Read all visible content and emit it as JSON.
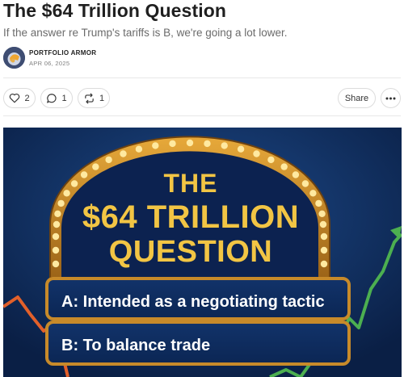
{
  "post": {
    "title": "The $64 Trillion Question",
    "subtitle": "If the answer re Trump's tariffs is B, we're going a lot lower.",
    "author": "PORTFOLIO ARMOR",
    "date": "APR 06, 2025"
  },
  "actions": {
    "likes": "2",
    "comments": "1",
    "restacks": "1",
    "share_label": "Share",
    "more_icon": "ellipsis-icon"
  },
  "hero_image": {
    "line1": "THE",
    "line2": "$64 TRILLION",
    "line3": "QUESTION",
    "option_a": "A: Intended as a negotiating tactic",
    "option_b": "B: To balance trade"
  },
  "colors": {
    "hero_bg": "#0d2752",
    "gold": "#f2c544",
    "frame": "#c78a2a",
    "trend_down": "#e2602a",
    "trend_up": "#4caf50"
  }
}
